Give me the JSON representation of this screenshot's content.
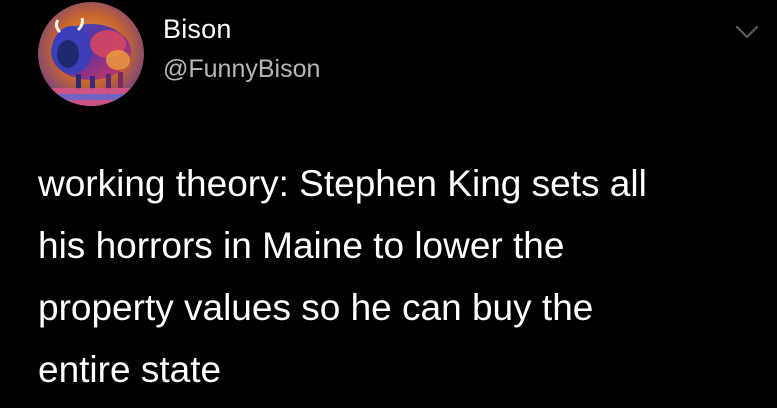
{
  "author": {
    "display_name": "Bison",
    "handle": "@FunnyBison",
    "avatar_icon": "bison-painting-avatar"
  },
  "menu": {
    "icon": "chevron-down-icon"
  },
  "tweet": {
    "lines": [
      "working theory: Stephen King sets all",
      "his horrors in Maine to lower the",
      "property values so he can buy the",
      "entire state"
    ]
  },
  "colors": {
    "background": "#000000",
    "name_text": "#ffffff",
    "handle_text": "#b8b8b8",
    "chevron": "#5a5a5a"
  }
}
